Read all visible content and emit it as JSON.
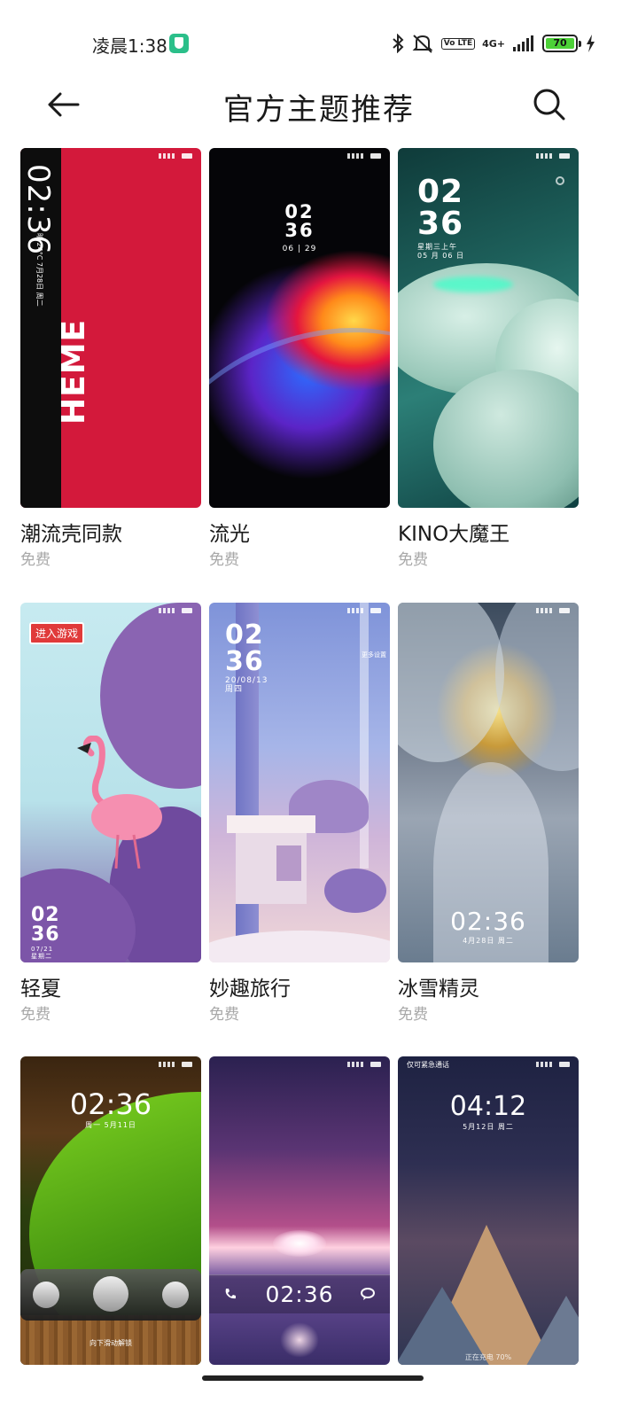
{
  "status_bar": {
    "time": "凌晨1:38",
    "network": "4G+",
    "volte": "Vo LTE",
    "battery": "70"
  },
  "header": {
    "title": "官方主题推荐",
    "back_icon": "arrow-left-icon",
    "search_icon": "search-icon"
  },
  "themes": [
    {
      "name": "潮流壳同款",
      "price": "免费",
      "wallpaper": {
        "time": "02:36",
        "date": "7月28日 周二",
        "weather": "晴 24°C",
        "brand": "HEME"
      }
    },
    {
      "name": "流光",
      "price": "免费",
      "wallpaper": {
        "hour": "02",
        "minute": "36",
        "date": "06 | 29"
      }
    },
    {
      "name": "KINO大魔王",
      "price": "免费",
      "wallpaper": {
        "hour": "02",
        "minute": "36",
        "weekday": "星期三上午",
        "date": "05 月 06 日"
      }
    },
    {
      "name": "轻夏",
      "price": "免费",
      "wallpaper": {
        "tag": "进入游戏",
        "hour": "02",
        "minute": "36",
        "date": "07/21",
        "weekday": "星期二"
      }
    },
    {
      "name": "妙趣旅行",
      "price": "免费",
      "wallpaper": {
        "hour": "02",
        "minute": "36",
        "date": "20/08/13",
        "weekday": "周四",
        "hint": "更多设置"
      }
    },
    {
      "name": "冰雪精灵",
      "price": "免费",
      "wallpaper": {
        "time": "02:36",
        "date": "4月28日 周二"
      }
    },
    {
      "wallpaper": {
        "time": "02:36",
        "date": "周一 5月11日",
        "unlock": "向下滑动解锁"
      }
    },
    {
      "wallpaper": {
        "time": "02:36"
      }
    },
    {
      "wallpaper": {
        "time": "04:12",
        "date": "5月12日 周二",
        "emergency": "仅可紧急通话",
        "charging": "正在充电 70%"
      }
    }
  ],
  "colors": {
    "title": "#1a1a1a",
    "price": "#a8a8a8",
    "battery_fill": "#4cd137"
  }
}
